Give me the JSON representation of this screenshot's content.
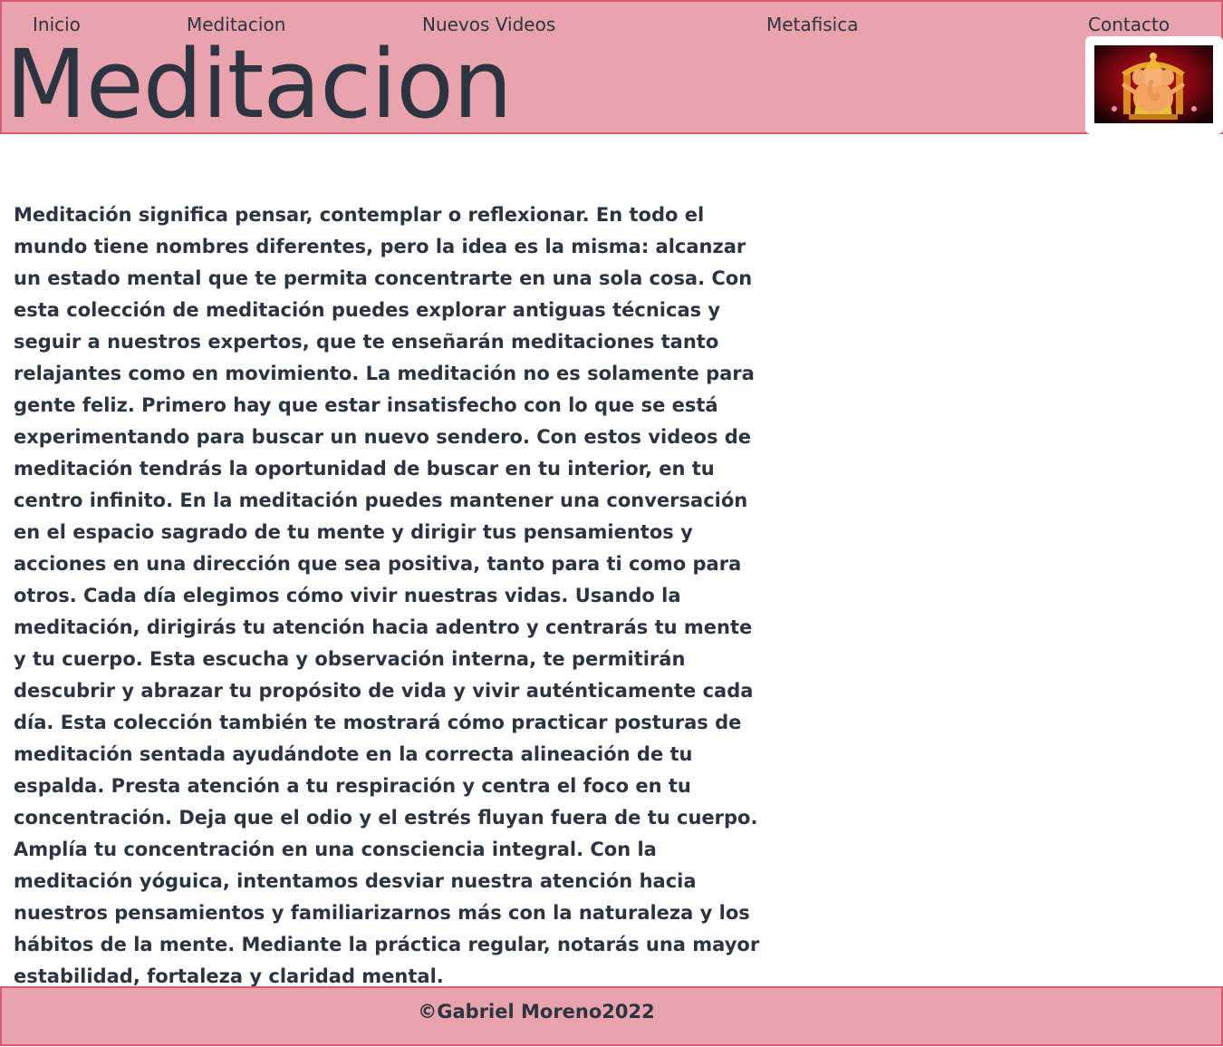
{
  "nav": {
    "items": [
      {
        "label": "Inicio"
      },
      {
        "label": "Meditacion"
      },
      {
        "label": "Nuevos Videos"
      },
      {
        "label": "Metafisica"
      },
      {
        "label": "Contacto"
      }
    ]
  },
  "header": {
    "title": "Meditacion",
    "logo_icon": "ganesha-image"
  },
  "main": {
    "paragraph": "Meditación significa pensar, contemplar o reflexionar. En todo el mundo tiene nombres diferentes, pero la idea es la misma: alcanzar un estado mental que te permita concentrarte en una sola cosa. Con esta colección de meditación puedes explorar antiguas técnicas y seguir a nuestros expertos, que te enseñarán meditaciones tanto relajantes como en movimiento. La meditación no es solamente para gente feliz. Primero hay que estar insatisfecho con lo que se está experimentando para buscar un nuevo sendero. Con estos videos de meditación tendrás la oportunidad de buscar en tu interior, en tu centro infinito. En la meditación puedes mantener una conversación en el espacio sagrado de tu mente y dirigir tus pensamientos y acciones en una dirección que sea positiva, tanto para ti como para otros. Cada día elegimos cómo vivir nuestras vidas. Usando la meditación, dirigirás tu atención hacia adentro y centrarás tu mente y tu cuerpo. Esta escucha y observación interna, te permitirán descubrir y abrazar tu propósito de vida y vivir auténticamente cada día. Esta colección también te mostrará cómo practicar posturas de meditación sentada ayudándote en la correcta alineación de tu espalda. Presta atención a tu respiración y centra el foco en tu concentración. Deja que el odio y el estrés fluyan fuera de tu cuerpo. Amplía tu concentración en una consciencia integral. Con la meditación yóguica, intentamos desviar nuestra atención hacia nuestros pensamientos y familiarizarnos más con la naturaleza y los hábitos de la mente. Mediante la práctica regular, notarás una mayor estabilidad, fortaleza y claridad mental."
  },
  "footer": {
    "copyright": "©Gabriel Moreno2022"
  },
  "colors": {
    "header_bg": "#e9a3ad",
    "border": "#d9596e",
    "text": "#2b3440"
  }
}
